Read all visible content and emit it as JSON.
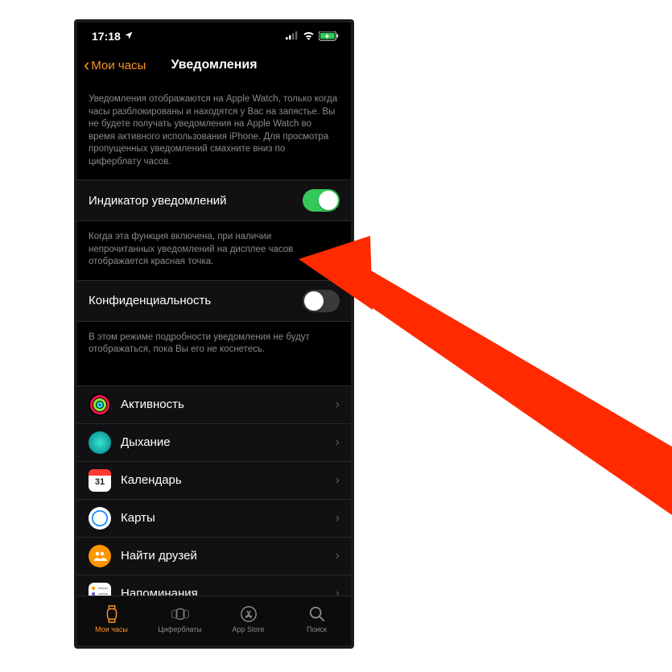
{
  "status": {
    "time": "17:18",
    "location_icon": "◀",
    "wifi": true,
    "battery": true
  },
  "nav": {
    "back_label": "Мои часы",
    "title": "Уведомления"
  },
  "intro_text": "Уведомления отображаются на Apple Watch, только когда часы разблокированы и находятся у Вас на запястье. Вы не будете получать уведомления на Apple Watch во время активного использования iPhone. Для просмотра пропущенных уведомлений смахните вниз по циферблату часов.",
  "toggles": {
    "indicator": {
      "label": "Индикатор уведомлений",
      "on": true,
      "desc": "Когда эта функция включена, при наличии непрочитанных уведомлений на дисплее часов отображается красная точка."
    },
    "privacy": {
      "label": "Конфиденциальность",
      "on": false,
      "desc": "В этом режиме подробности уведомления не будут отображаться, пока Вы его не коснетесь."
    }
  },
  "apps": [
    {
      "id": "activity",
      "label": "Активность"
    },
    {
      "id": "breathe",
      "label": "Дыхание"
    },
    {
      "id": "calendar",
      "label": "Календарь"
    },
    {
      "id": "maps",
      "label": "Карты"
    },
    {
      "id": "friends",
      "label": "Найти друзей"
    },
    {
      "id": "reminders",
      "label": "Напоминания"
    }
  ],
  "tabs": [
    {
      "id": "my-watch",
      "label": "Мои часы",
      "active": true
    },
    {
      "id": "faces",
      "label": "Циферблаты",
      "active": false
    },
    {
      "id": "appstore",
      "label": "App Store",
      "active": false
    },
    {
      "id": "search",
      "label": "Поиск",
      "active": false
    }
  ],
  "annotation": {
    "arrow_color": "#ff2a00",
    "target": "toggles.indicator"
  }
}
